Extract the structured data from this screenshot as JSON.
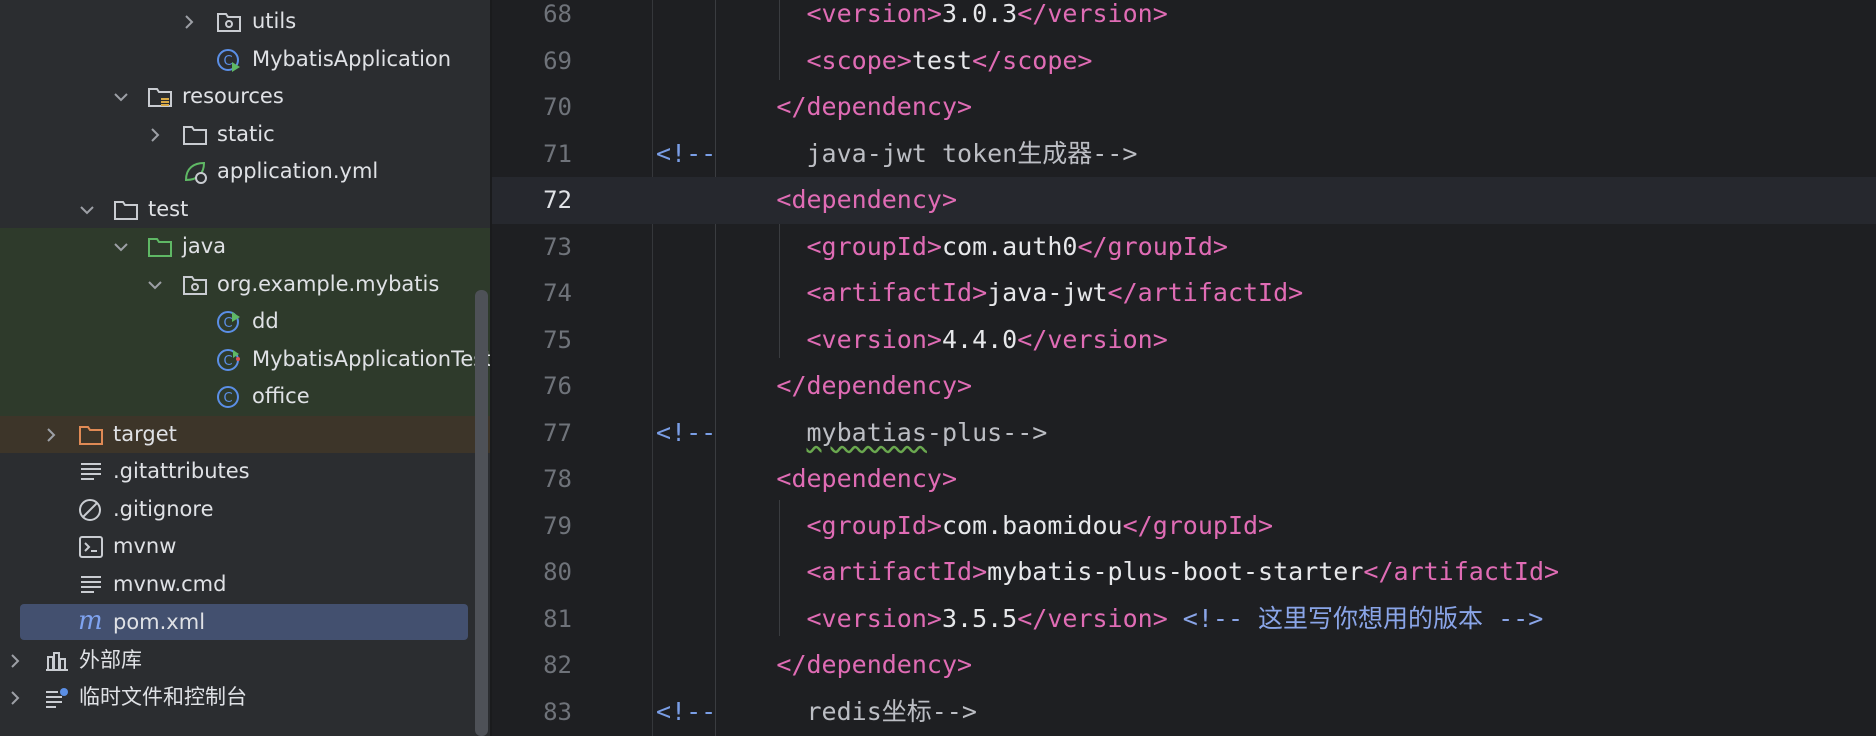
{
  "tree": {
    "items": [
      {
        "label": "utils",
        "icon": "package-folder-icon",
        "expanded": false
      },
      {
        "label": "MybatisApplication",
        "icon": "spring-boot-class-icon"
      },
      {
        "label": "resources",
        "icon": "resources-folder-icon",
        "expanded": true
      },
      {
        "label": "static",
        "icon": "folder-icon",
        "expanded": false
      },
      {
        "label": "application.yml",
        "icon": "spring-config-icon"
      },
      {
        "label": "test",
        "icon": "folder-icon",
        "expanded": true
      },
      {
        "label": "java",
        "icon": "test-folder-icon",
        "expanded": true
      },
      {
        "label": "org.example.mybatis",
        "icon": "package-folder-icon",
        "expanded": true
      },
      {
        "label": "dd",
        "icon": "run-class-icon"
      },
      {
        "label": "MybatisApplicationTest",
        "icon": "test-class-icon"
      },
      {
        "label": "office",
        "icon": "class-icon"
      },
      {
        "label": "target",
        "icon": "excluded-folder-icon",
        "expanded": false
      },
      {
        "label": ".gitattributes",
        "icon": "text-file-icon"
      },
      {
        "label": ".gitignore",
        "icon": "ignore-file-icon"
      },
      {
        "label": "mvnw",
        "icon": "shell-script-icon"
      },
      {
        "label": "mvnw.cmd",
        "icon": "text-file-icon"
      },
      {
        "label": "pom.xml",
        "icon": "maven-icon",
        "selected": true
      },
      {
        "label": "外部库",
        "icon": "library-icon",
        "expanded": false
      },
      {
        "label": "临时文件和控制台",
        "icon": "scratches-icon",
        "expanded": false
      }
    ]
  },
  "editor": {
    "current_line": "72",
    "lines": [
      {
        "n": "68",
        "pre": "<version>",
        "text": "3.0.3",
        "post": "</version>"
      },
      {
        "n": "69",
        "pre": "<scope>",
        "text": "test",
        "post": "</scope>"
      },
      {
        "n": "70",
        "pre": "</dependency>",
        "text": "",
        "post": ""
      },
      {
        "n": "71",
        "comment_open": "<!--",
        "comment_body": "java-jwt token生成器-->"
      },
      {
        "n": "72",
        "pre": "<dependency>",
        "text": "",
        "post": ""
      },
      {
        "n": "73",
        "pre": "<groupId>",
        "text": "com.auth0",
        "post": "</groupId>"
      },
      {
        "n": "74",
        "pre": "<artifactId>",
        "text": "java-jwt",
        "post": "</artifactId>"
      },
      {
        "n": "75",
        "pre": "<version>",
        "text": "4.4.0",
        "post": "</version>"
      },
      {
        "n": "76",
        "pre": "</dependency>",
        "text": "",
        "post": ""
      },
      {
        "n": "77",
        "comment_open": "<!--",
        "comment_body_squig": "mybatias",
        "comment_body": "-plus-->"
      },
      {
        "n": "78",
        "pre": "<dependency>",
        "text": "",
        "post": ""
      },
      {
        "n": "79",
        "pre": "<groupId>",
        "text": "com.baomidou",
        "post": "</groupId>"
      },
      {
        "n": "80",
        "pre": "<artifactId>",
        "text": "mybatis-plus-boot-starter",
        "post": "</artifactId>"
      },
      {
        "n": "81",
        "pre": "<version>",
        "text": "3.5.5",
        "post": "</version>",
        "trail_comment": " <!-- 这里写你想用的版本 -->"
      },
      {
        "n": "82",
        "pre": "</dependency>",
        "text": "",
        "post": ""
      },
      {
        "n": "83",
        "comment_open": "<!--",
        "comment_body": "redis坐标-->"
      }
    ]
  },
  "colors": {
    "tag": "#e06cb5",
    "comment": "#8aa5e8",
    "selection": "#43506f",
    "test_bg": "#2e3a2b",
    "excluded_bg": "#3d3529"
  }
}
